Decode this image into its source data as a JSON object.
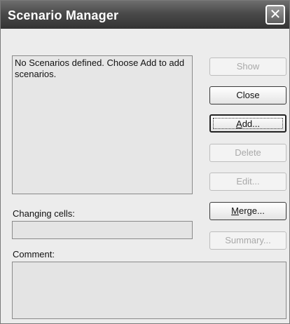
{
  "window": {
    "title": "Scenario Manager",
    "close_glyph": "✕"
  },
  "scenarios": {
    "empty_message": "No Scenarios defined. Choose Add to add scenarios."
  },
  "buttons": {
    "show": "Show",
    "close": "Close",
    "add_prefix": "A",
    "add_rest": "dd...",
    "delete": "Delete",
    "edit": "Edit...",
    "merge_prefix": "M",
    "merge_rest": "erge...",
    "summary": "Summary..."
  },
  "labels": {
    "changing_cells": "Changing cells:",
    "comment": "Comment:"
  },
  "fields": {
    "changing_cells_value": "",
    "comment_value": ""
  },
  "states": {
    "show_enabled": false,
    "delete_enabled": false,
    "edit_enabled": false,
    "summary_enabled": false,
    "default_button": "Add"
  }
}
